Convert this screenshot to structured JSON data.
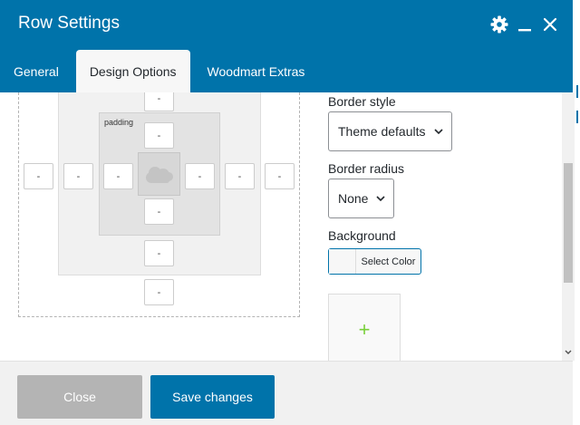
{
  "window": {
    "title": "Row Settings"
  },
  "colors": {
    "accent": "#0073aa",
    "add_plus": "#7ad03a",
    "close_button_bg": "#b4b4b4"
  },
  "header_icons": [
    "gear-icon",
    "minimize-icon",
    "close-icon"
  ],
  "tabs": [
    {
      "label": "General",
      "active": false
    },
    {
      "label": "Design Options",
      "active": true
    },
    {
      "label": "Woodmart Extras",
      "active": false
    }
  ],
  "box_editor": {
    "padding_label": "padding",
    "margin_top": "-",
    "border_top": "-",
    "padding_top": "-",
    "margin_left": "-",
    "border_left": "-",
    "padding_left": "-",
    "padding_right": "-",
    "border_right": "-",
    "margin_right": "-",
    "padding_bottom": "-",
    "border_bottom": "-",
    "margin_bottom": "-"
  },
  "design": {
    "border_style_label": "Border style",
    "border_style_value": "Theme defaults",
    "border_radius_label": "Border radius",
    "border_radius_value": "None",
    "background_label": "Background",
    "select_color_label": "Select Color",
    "add_image_symbol": "+"
  },
  "footer": {
    "close_label": "Close",
    "save_label": "Save changes"
  }
}
